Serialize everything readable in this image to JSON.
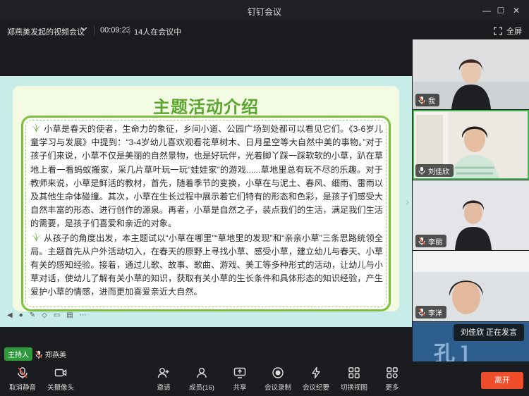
{
  "window": {
    "title": "钉钉会议",
    "minimize": "—",
    "maximize": "☐",
    "close": "✕"
  },
  "infobar": {
    "host_meeting": "郑燕美发起的视频会议",
    "duration": "00:09:23",
    "participants_in_meeting": "14人在会议中",
    "fullscreen_label": "全屏"
  },
  "slide": {
    "title": "主题活动介绍",
    "paragraph1": "小草是春天的使者，生命力的象征，乡间小道、公园广场到处都可以看见它们。《3-6岁儿童学习与发展》中提到：“3-4岁幼儿喜欢观看花草树木、日月星空等大自然中美的事物。”对于孩子们来说，小草不仅是美丽的自然景物，也是好玩伴，光着脚丫踩一踩软软的小草，趴在草地上看一看蚂蚁搬家，采几片草叶玩一玩“娃娃家”的游戏......草地里总有玩不尽的乐趣。对于教师来说，小草是鲜活的教材，首先，随着季节的变换，小草在与泥土、春风、细雨、雷雨以及其他生命体碰撞。其次，小草在生长过程中展示着它们特有的形态和色彩，是孩子们感受大自然丰富的形态、进行创作的源泉。再者，小草是自然之子，装点我们的生活，满足我们生活的需要，是孩子们喜爱和亲近的对象。",
    "paragraph2": "从孩子的角度出发，本主题试以“小草在哪里”“草地里的发现”和“亲亲小草”三条思路统领全局。主题首先从户外活动切入，在春天的原野上寻找小草、感受小草，建立幼儿与春天、小草有关的感知经验。接着，通过儿歌、故事、歌曲、游戏、美工等多种形式的活动，让幼儿与小草对话，使幼儿了解有关小草的知识，获取有关小草的生长条件和具体形态的知识经验，产生爱护小草的情感，进而更加喜爱亲近大自然。"
  },
  "participants": [
    {
      "name": "我",
      "active": false
    },
    {
      "name": "刘佳欣",
      "active": true
    },
    {
      "name": "李丽",
      "active": false
    },
    {
      "name": "李洋",
      "active": false
    }
  ],
  "speaking_indicator": "刘佳欣  正在发言",
  "host": {
    "badge": "主持人",
    "name": "郑燕美"
  },
  "toolbar": {
    "mute": "取消静音",
    "camera": "关摄像头",
    "invite": "邀请",
    "members": "成员(16)",
    "share": "共享",
    "record": "会议录制",
    "minutes": "会议纪要",
    "switch_view": "切换视图",
    "more": "更多",
    "leave": "离开"
  },
  "colors": {
    "accent_green": "#3bb84a",
    "leave_red": "#f04d2b",
    "slide_title_green": "#5aa630"
  }
}
